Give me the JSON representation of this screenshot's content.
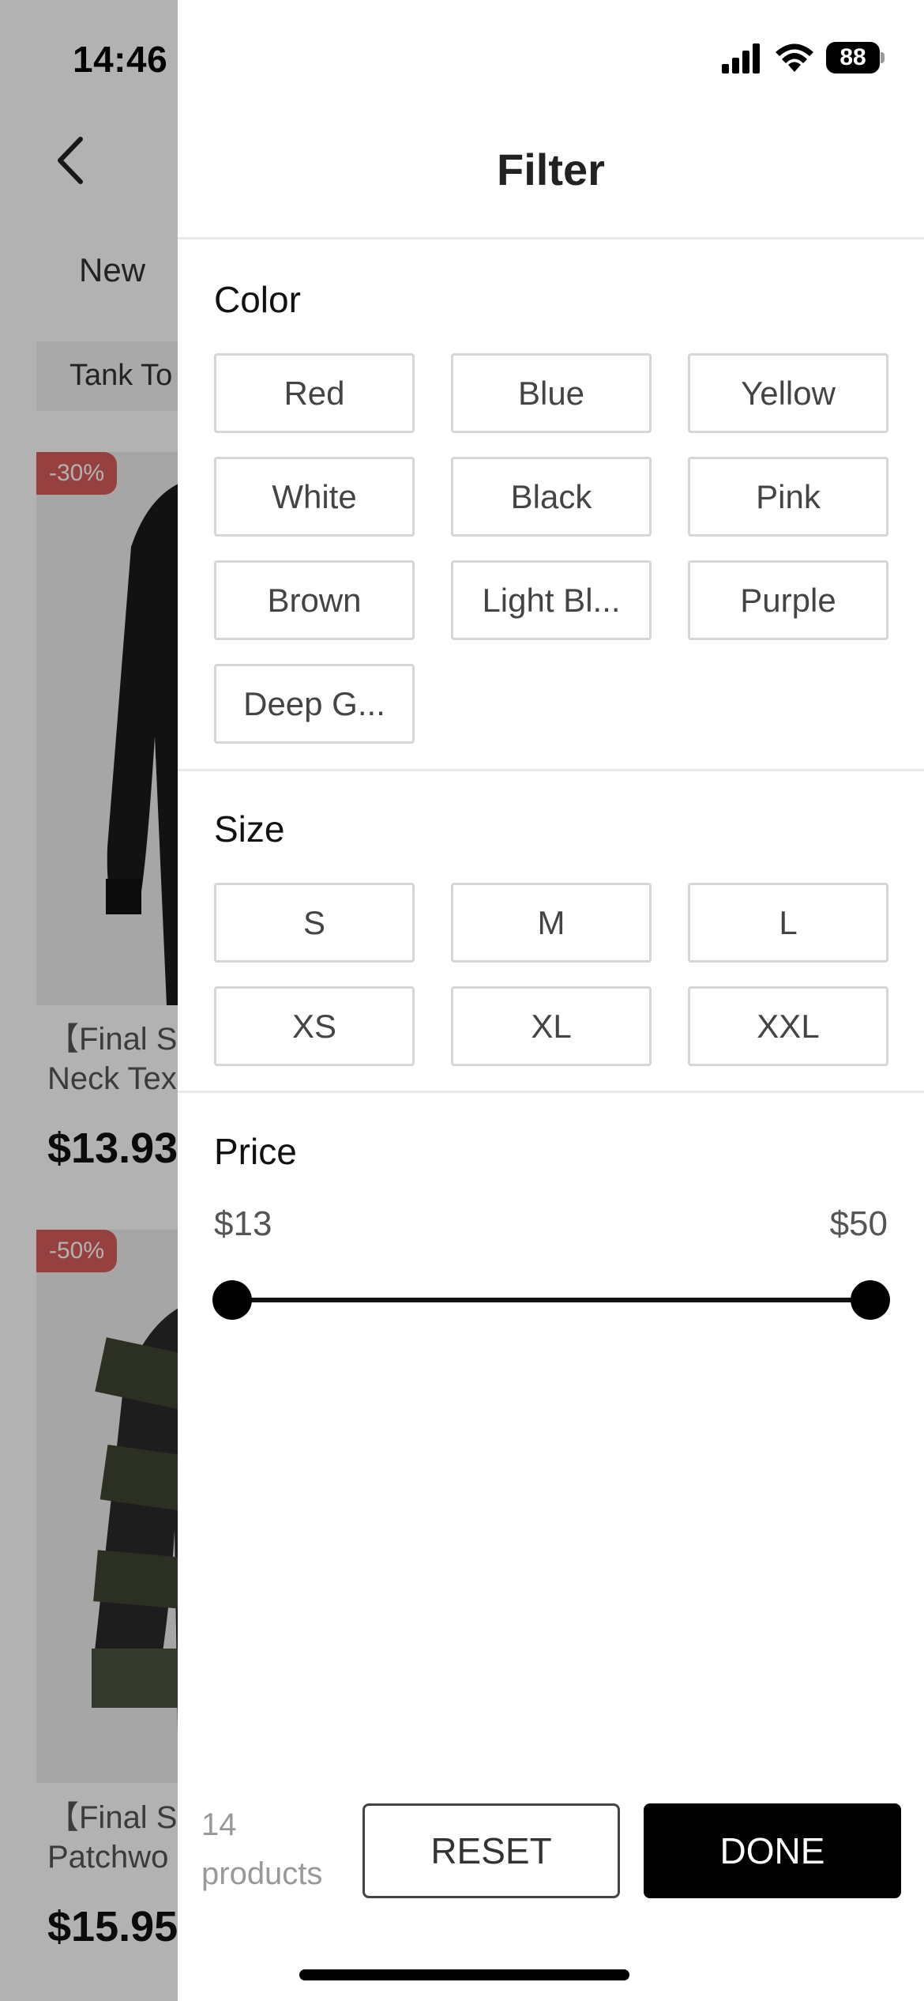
{
  "status_bar": {
    "time": "14:46",
    "battery_level": "88",
    "icons": [
      "signal-icon",
      "wifi-icon",
      "battery-icon"
    ]
  },
  "background_page": {
    "tab_label": "New",
    "category_chip": "Tank To",
    "products": [
      {
        "discount": "-30%",
        "name": "【Final Sa\nNeck Tex",
        "price": "$13.93",
        "image_color": "#1a1a1a"
      },
      {
        "discount": "-50%",
        "name": "【Final Sa\nPatchwo",
        "price": "$15.95",
        "image_color": "#3e4632"
      }
    ]
  },
  "filter": {
    "title": "Filter",
    "color_section": {
      "title": "Color",
      "options": [
        "Red",
        "Blue",
        "Yellow",
        "White",
        "Black",
        "Pink",
        "Brown",
        "Light Bl...",
        "Purple",
        "Deep G..."
      ]
    },
    "size_section": {
      "title": "Size",
      "options": [
        "S",
        "M",
        "L",
        "XS",
        "XL",
        "XXL"
      ]
    },
    "price_section": {
      "title": "Price",
      "min_label": "$13",
      "max_label": "$50"
    },
    "footer": {
      "count_text": "14\nproducts",
      "reset_label": "RESET",
      "done_label": "DONE"
    }
  },
  "colors": {
    "accent": "#000000",
    "discount_badge": "#d85c5c",
    "chip_border": "#d6d6d6"
  }
}
